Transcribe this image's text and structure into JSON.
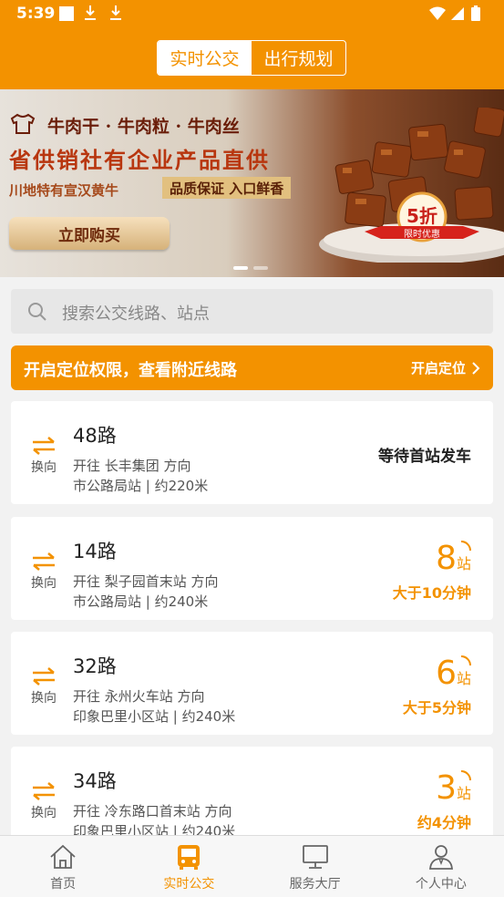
{
  "status": {
    "time": "5:39"
  },
  "header": {
    "tabs": [
      {
        "label": "实时公交",
        "active": true
      },
      {
        "label": "出行规划",
        "active": false
      }
    ]
  },
  "banner": {
    "line1": "牛肉干 · 牛肉粒 · 牛肉丝",
    "line2": "省供销社有企业产品直供",
    "line3a": "川地特有宣汉黄牛",
    "line3b": "品质保证  入口鲜香",
    "buy_label": "立即购买",
    "discount": "5折",
    "discount_sub": "限时优惠"
  },
  "search": {
    "placeholder": "搜索公交线路、站点"
  },
  "location": {
    "text": "开启定位权限，查看附近线路",
    "button": "开启定位"
  },
  "routes": [
    {
      "name": "48路",
      "direction": "开往 长丰集团 方向",
      "stop": "市公路局站 | 约220米",
      "swap": "换向",
      "status": "等待首站发车"
    },
    {
      "name": "14路",
      "direction": "开往 梨子园首末站 方向",
      "stop": "市公路局站 | 约240米",
      "swap": "换向",
      "stations": "8",
      "unit": "站",
      "time": "大于10分钟"
    },
    {
      "name": "32路",
      "direction": "开往 永州火车站 方向",
      "stop": "印象巴里小区站 | 约240米",
      "swap": "换向",
      "stations": "6",
      "unit": "站",
      "time": "大于5分钟"
    },
    {
      "name": "34路",
      "direction": "开往 冷东路口首末站 方向",
      "stop": "印象巴里小区站 | 约240米",
      "swap": "换向",
      "stations": "3",
      "unit": "站",
      "time": "约4分钟"
    }
  ],
  "tabbar": [
    {
      "label": "首页",
      "icon": "home-icon",
      "active": false
    },
    {
      "label": "实时公交",
      "icon": "bus-icon",
      "active": true
    },
    {
      "label": "服务大厅",
      "icon": "monitor-icon",
      "active": false
    },
    {
      "label": "个人中心",
      "icon": "person-icon",
      "active": false
    }
  ],
  "colors": {
    "accent": "#f39200",
    "background": "#f2f2f2",
    "inactive": "#666666"
  }
}
